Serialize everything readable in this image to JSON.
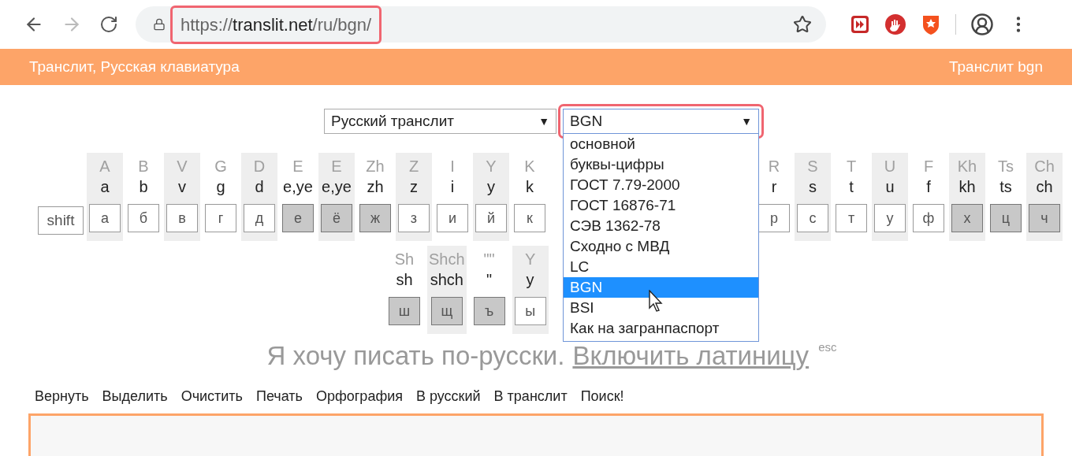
{
  "browser": {
    "url_scheme": "https://",
    "url_host": "translit.net",
    "url_path": "/ru/bgn/",
    "url_highlighted": true,
    "forward_disabled": true
  },
  "header": {
    "title": "Транслит, Русская клавиатура",
    "right": "Транслит bgn"
  },
  "selects": [
    {
      "value": "Русский транслит",
      "arrow": "▼",
      "highlighted": false,
      "open": false
    },
    {
      "value": "BGN",
      "arrow": "▼",
      "highlighted": true,
      "open": true
    }
  ],
  "dropdown_options": [
    {
      "label": "основной",
      "selected": false
    },
    {
      "label": "буквы-цифры",
      "selected": false
    },
    {
      "label": "ГОСТ 7.79-2000",
      "selected": false
    },
    {
      "label": "ГОСТ 16876-71",
      "selected": false
    },
    {
      "label": "СЭВ 1362-78",
      "selected": false
    },
    {
      "label": "Сходно с МВД",
      "selected": false
    },
    {
      "label": "LC",
      "selected": false
    },
    {
      "label": "BGN",
      "selected": true
    },
    {
      "label": "BSI",
      "selected": false
    },
    {
      "label": "Как на загранпаспорт",
      "selected": false
    }
  ],
  "keyboard": {
    "row_1_left": [
      {
        "kind": "shift",
        "key": "shift"
      },
      {
        "kind": "letter",
        "upper": "A",
        "lower": "a",
        "key": "а",
        "shaded": true,
        "pressed": false
      },
      {
        "kind": "letter",
        "upper": "B",
        "lower": "b",
        "key": "б",
        "shaded": false,
        "pressed": false
      },
      {
        "kind": "letter",
        "upper": "V",
        "lower": "v",
        "key": "в",
        "shaded": true,
        "pressed": false
      },
      {
        "kind": "letter",
        "upper": "G",
        "lower": "g",
        "key": "г",
        "shaded": false,
        "pressed": false
      },
      {
        "kind": "letter",
        "upper": "D",
        "lower": "d",
        "key": "д",
        "shaded": true,
        "pressed": false
      },
      {
        "kind": "letter",
        "upper": "E",
        "lower": "e,ye",
        "key": "е",
        "shaded": false,
        "pressed": true
      },
      {
        "kind": "letter",
        "upper": "E",
        "lower": "e,ye",
        "key": "ё",
        "shaded": true,
        "pressed": true
      },
      {
        "kind": "letter",
        "upper": "Zh",
        "lower": "zh",
        "key": "ж",
        "shaded": false,
        "pressed": true
      },
      {
        "kind": "letter",
        "upper": "Z",
        "lower": "z",
        "key": "з",
        "shaded": true,
        "pressed": false
      },
      {
        "kind": "letter",
        "upper": "I",
        "lower": "i",
        "key": "и",
        "shaded": false,
        "pressed": false
      },
      {
        "kind": "letter",
        "upper": "Y",
        "lower": "y",
        "key": "й",
        "shaded": true,
        "pressed": false
      },
      {
        "kind": "letter",
        "upper": "K",
        "lower": "k",
        "key": "к",
        "shaded": false,
        "pressed": false
      }
    ],
    "row_1_right": [
      {
        "kind": "letter",
        "upper": "R",
        "lower": "r",
        "key": "р",
        "shaded": false,
        "pressed": false
      },
      {
        "kind": "letter",
        "upper": "S",
        "lower": "s",
        "key": "с",
        "shaded": true,
        "pressed": false
      },
      {
        "kind": "letter",
        "upper": "T",
        "lower": "t",
        "key": "т",
        "shaded": false,
        "pressed": false
      },
      {
        "kind": "letter",
        "upper": "U",
        "lower": "u",
        "key": "у",
        "shaded": true,
        "pressed": false
      },
      {
        "kind": "letter",
        "upper": "F",
        "lower": "f",
        "key": "ф",
        "shaded": false,
        "pressed": false
      },
      {
        "kind": "letter",
        "upper": "Kh",
        "lower": "kh",
        "key": "х",
        "shaded": true,
        "pressed": true
      },
      {
        "kind": "letter",
        "upper": "Ts",
        "lower": "ts",
        "key": "ц",
        "shaded": false,
        "pressed": true
      },
      {
        "kind": "letter",
        "upper": "Ch",
        "lower": "ch",
        "key": "ч",
        "shaded": true,
        "pressed": true
      }
    ],
    "row_2": [
      {
        "kind": "letter",
        "upper": "Sh",
        "lower": "sh",
        "key": "ш",
        "shaded": false,
        "pressed": true
      },
      {
        "kind": "letter",
        "upper": "Shch",
        "lower": "shch",
        "key": "щ",
        "shaded": true,
        "pressed": true
      },
      {
        "kind": "letter",
        "upper": "\"\"",
        "lower": "\"",
        "key": "ъ",
        "shaded": false,
        "pressed": true
      },
      {
        "kind": "letter",
        "upper": "Y",
        "lower": "y",
        "key": "ы",
        "shaded": true,
        "pressed": false
      }
    ]
  },
  "prompt": {
    "text": "Я хочу писать по-русски.",
    "link": "Включить латиницу",
    "hint": "esc"
  },
  "toolbar": [
    "Вернуть",
    "Выделить",
    "Очистить",
    "Печать",
    "Орфография",
    "В русский",
    "В транслит",
    "Поиск!"
  ]
}
